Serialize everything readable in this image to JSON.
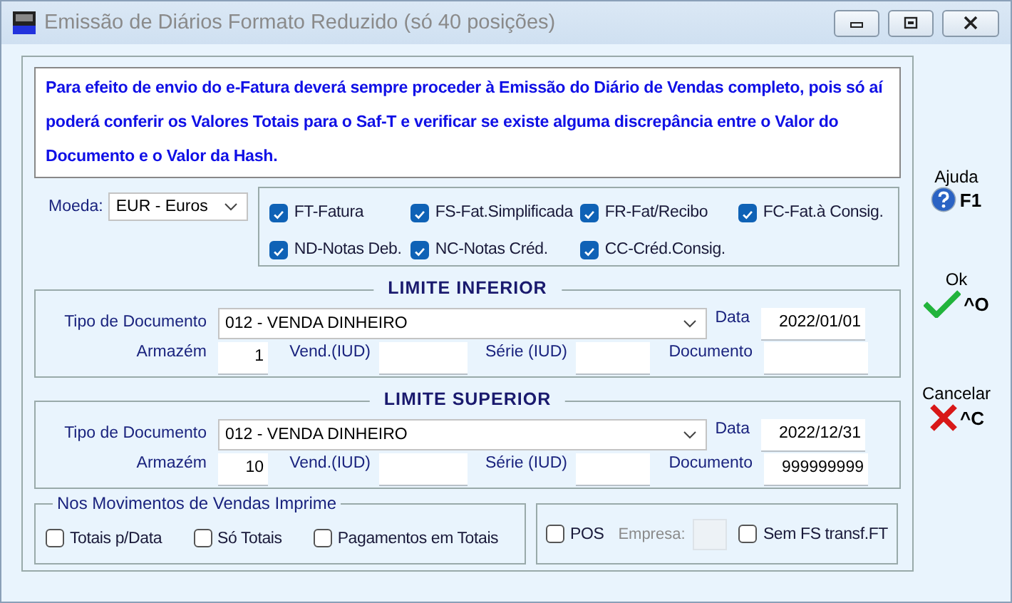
{
  "window": {
    "title": "Emissão de Diários Formato Reduzido (só 40 posições)"
  },
  "notice": "Para efeito de envio do e-Fatura deverá sempre proceder à Emissão do Diário de Vendas completo, pois só aí poderá conferir os Valores Totais para o Saf-T e  verificar se existe alguma  discrepância entre  o Valor do Documento e o Valor da Hash.",
  "currency": {
    "label": "Moeda:",
    "value": "EUR - Euros"
  },
  "doc_types": [
    {
      "label": "FT-Fatura",
      "checked": true
    },
    {
      "label": "FS-Fat.Simplificada",
      "checked": true
    },
    {
      "label": "FR-Fat/Recibo",
      "checked": true
    },
    {
      "label": "FC-Fat.à Consig.",
      "checked": true
    },
    {
      "label": "ND-Notas Deb.",
      "checked": true
    },
    {
      "label": "NC-Notas Créd.",
      "checked": true
    },
    {
      "label": "CC-Créd.Consig.",
      "checked": true
    }
  ],
  "limits": [
    {
      "title": "LIMITE INFERIOR",
      "doc_type_label": "Tipo de Documento",
      "doc_type": "012 - VENDA DINHEIRO",
      "date_label": "Data",
      "date": "2022/01/01",
      "warehouse_label": "Armazém",
      "warehouse": "1",
      "seller_label": "Vend.(IUD)",
      "series_label": "Série (IUD)",
      "document_label": "Documento"
    },
    {
      "title": "LIMITE SUPERIOR",
      "doc_type_label": "Tipo de Documento",
      "doc_type": "012 - VENDA DINHEIRO",
      "date_label": "Data",
      "date": "2022/12/31",
      "warehouse_label": "Armazém",
      "warehouse": "10",
      "seller_label": "Vend.(IUD)",
      "series_label": "Série (IUD)",
      "document_label": "Documento",
      "document": "999999999"
    }
  ],
  "print_options": {
    "title": "Nos Movimentos de Vendas Imprime",
    "options": [
      {
        "label": "Totais p/Data",
        "checked": false
      },
      {
        "label": "Só Totais",
        "checked": false
      },
      {
        "label": "Pagamentos em Totais",
        "checked": false
      }
    ]
  },
  "pos": {
    "label": "POS",
    "checked": false
  },
  "company": {
    "label": "Empresa:",
    "disabled": true
  },
  "no_fs": {
    "label": "Sem FS transf.FT",
    "checked": false
  },
  "actions": [
    {
      "kind": "help",
      "label": "Ajuda",
      "shortcut": "F1"
    },
    {
      "kind": "ok",
      "label": "Ok",
      "shortcut": "^O"
    },
    {
      "kind": "cancel",
      "label": "Cancelar",
      "shortcut": "^C"
    }
  ]
}
